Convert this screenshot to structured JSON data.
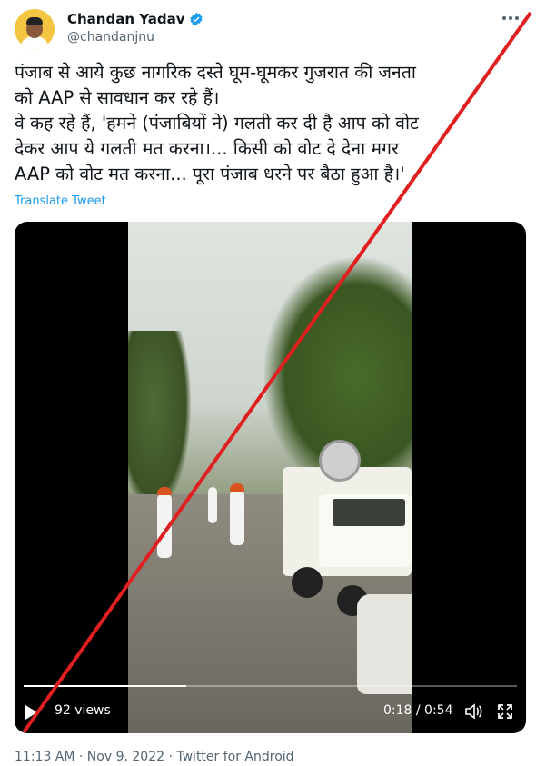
{
  "tweet": {
    "author_name": "Chandan Yadav",
    "author_handle": "@chandanjnu",
    "text_lines": [
      "पंजाब से आये कुछ नागरिक दस्ते घूम-घूमकर गुजरात की जनता",
      "को AAP से सावधान कर रहे हैं।",
      "वे कह रहे हैं, 'हमने (पंजाबियों ने) गलती कर दी है आप को वोट",
      "देकर आप ये गलती मत करना।... किसी को वोट दे देना मगर",
      "AAP को वोट मत करना... पूरा पंजाब धरने पर बैठा हुआ है।'"
    ],
    "translate_label": "Translate Tweet",
    "footer": "11:13 AM · Nov 9, 2022 · Twitter for Android"
  },
  "video": {
    "views": "92 views",
    "time": "0:18 / 0:54",
    "progress_fraction": 0.33
  },
  "colors": {
    "link": "#1d9bf0",
    "verified": "#1d9bf0",
    "slash": "#e02020"
  },
  "icons": [
    "verified-badge-icon",
    "more-options-icon",
    "play-icon",
    "volume-icon",
    "fullscreen-icon"
  ]
}
